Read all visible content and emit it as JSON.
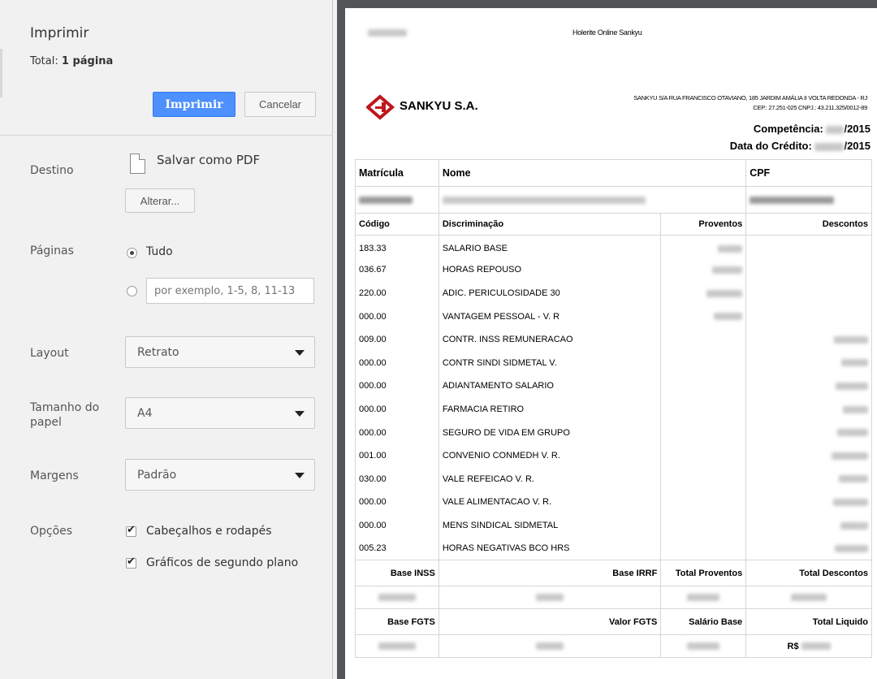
{
  "print": {
    "title": "Imprimir",
    "total_label": "Total:",
    "total_value": "1 página",
    "print_button": "Imprimir",
    "cancel_button": "Cancelar",
    "destination": {
      "label": "Destino",
      "value": "Salvar como PDF",
      "change_button": "Alterar..."
    },
    "pages": {
      "label": "Páginas",
      "all_option": "Tudo",
      "range_placeholder": "por exemplo, 1-5, 8, 11-13",
      "all_selected": true
    },
    "layout": {
      "label": "Layout",
      "value": "Retrato"
    },
    "paper": {
      "label_line1": "Tamanho do",
      "label_line2": "papel",
      "value": "A4"
    },
    "margins": {
      "label": "Margens",
      "value": "Padrão"
    },
    "options": {
      "label": "Opções",
      "headers_footers": "Cabeçalhos e rodapés",
      "background_graphics": "Gráficos de segundo plano",
      "headers_checked": true,
      "background_checked": true
    }
  },
  "document": {
    "header_title": "Holerite Online Sankyu",
    "company_name": "SANKYU S.A.",
    "company_address": "SANKYU S/A RUA FRANCISCO OTAVIANO, 185 JARDIM AMÁLIA II VOLTA REDONDA - RJ",
    "company_cep": "CEP.: 27.251-025 CNPJ.: 43.211.325/0012-89",
    "competencia_label": "Competência:",
    "competencia_year": "/2015",
    "credito_label": "Data do Crédito:",
    "credito_year": "/2015",
    "id_headers": [
      "Matrícula",
      "Nome",
      "CPF"
    ],
    "columns": [
      "Código",
      "Discriminação",
      "Proventos",
      "Descontos"
    ],
    "items": [
      {
        "code": "183.33",
        "desc": "SALARIO BASE",
        "type": "provento"
      },
      {
        "code": "036.67",
        "desc": "HORAS REPOUSO",
        "type": "provento"
      },
      {
        "code": "220.00",
        "desc": "ADIC. PERICULOSIDADE 30",
        "type": "provento"
      },
      {
        "code": "000.00",
        "desc": "VANTAGEM PESSOAL - V. R",
        "type": "provento"
      },
      {
        "code": "009.00",
        "desc": "CONTR. INSS REMUNERACAO",
        "type": "desconto"
      },
      {
        "code": "000.00",
        "desc": "CONTR SINDI SIDMETAL V.",
        "type": "desconto"
      },
      {
        "code": "000.00",
        "desc": "ADIANTAMENTO SALARIO",
        "type": "desconto"
      },
      {
        "code": "000.00",
        "desc": "FARMACIA RETIRO",
        "type": "desconto"
      },
      {
        "code": "000.00",
        "desc": "SEGURO DE VIDA EM GRUPO",
        "type": "desconto"
      },
      {
        "code": "001.00",
        "desc": "CONVENIO CONMEDH V. R.",
        "type": "desconto"
      },
      {
        "code": "030.00",
        "desc": "VALE REFEICAO V. R.",
        "type": "desconto"
      },
      {
        "code": "000.00",
        "desc": "VALE ALIMENTACAO V. R.",
        "type": "desconto"
      },
      {
        "code": "000.00",
        "desc": "MENS SINDICAL SIDMETAL",
        "type": "desconto"
      },
      {
        "code": "005.23",
        "desc": "HORAS NEGATIVAS BCO HRS",
        "type": "desconto"
      }
    ],
    "totals_row1": [
      "Base INSS",
      "Base IRRF",
      "Total Proventos",
      "Total Descontos"
    ],
    "totals_row2": [
      "Base FGTS",
      "Valor FGTS",
      "Salário Base",
      "Total Liquido"
    ],
    "currency": "R$"
  }
}
